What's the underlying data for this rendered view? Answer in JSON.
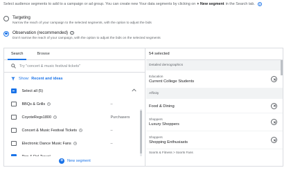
{
  "intro": {
    "text_before": "Select audience segments to add to a campaign or ad group. You can create new Your data segments by clicking on",
    "bold": "+ New segment",
    "text_after": "in the Search tab."
  },
  "targeting": {
    "title": "Targeting",
    "description": "Narrow the reach of your campaign to the selected segments, with the option to adjust the bids",
    "selected": false
  },
  "observation": {
    "title": "Observation (recommended)",
    "description": "Don't narrow the reach of your campaign, with the option to adjust the bids on the selected segments",
    "selected": true
  },
  "tabs": [
    {
      "label": "Search",
      "active": true
    },
    {
      "label": "Browse",
      "active": false
    }
  ],
  "search": {
    "placeholder": "Try \"concert & music festival tickets\""
  },
  "show": {
    "label": "Show:",
    "value": "Recent and ideas"
  },
  "select_all": {
    "label": "Select all (5)"
  },
  "segments": [
    {
      "label": "BBQs & Grills",
      "extra": "–"
    },
    {
      "label": "CoyoteRegs1800",
      "extra": "Purchasers"
    },
    {
      "label": "Concert & Music Festival Tickets",
      "extra": "–"
    },
    {
      "label": "Electronic Dance Music Fans",
      "extra": "–"
    },
    {
      "label": "Pop & Rol Travel",
      "extra": ""
    }
  ],
  "new_segment": {
    "label": "New segment"
  },
  "selected_panel": {
    "header": "54 selected",
    "groups": [
      {
        "title": "Detailed demographics",
        "items": [
          {
            "category": "Education",
            "name": "Current College Students"
          }
        ]
      },
      {
        "title": "Affinity",
        "items": [
          {
            "category": "",
            "name": "Food & Dining"
          },
          {
            "category": "Shoppers",
            "name": "Luxury Shoppers"
          },
          {
            "category": "Shoppers",
            "name": "Shopping Enthusiasts"
          }
        ]
      }
    ],
    "cut_header": "Sports & Fitness > Sports Fans"
  },
  "colors": {
    "accent": "#1a73e8",
    "border": "#dadce0",
    "group_bg": "#f1f3f4"
  },
  "icons": [
    "help-icon",
    "search-icon",
    "filter-icon",
    "chevron-up-icon",
    "clock-icon",
    "remove-icon",
    "plus-icon"
  ]
}
